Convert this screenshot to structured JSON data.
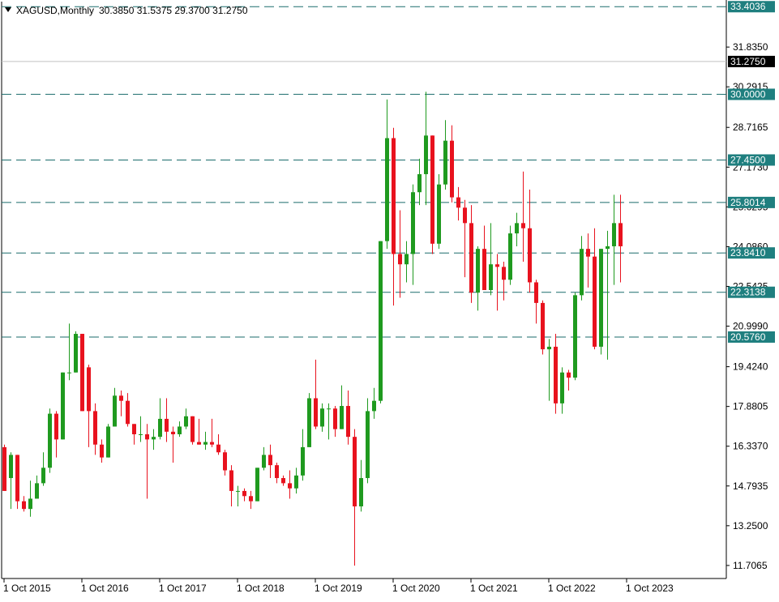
{
  "chart_data": {
    "type": "candlestick",
    "symbol": "XAGUSD",
    "timeframe": "Monthly",
    "header": {
      "symbol_timeframe": "XAGUSD,Monthly",
      "ohlc": "30.3850 31.5375 29.3700 31.2750"
    },
    "ylim": [
      11.2,
      33.6
    ],
    "y_ticks": [
      "31.8350",
      "30.2915",
      "28.7165",
      "27.1730",
      "25.6295",
      "24.0860",
      "22.5425",
      "20.9990",
      "19.4240",
      "17.8805",
      "16.3370",
      "14.7935",
      "13.2500",
      "11.7065"
    ],
    "y_tick_values": [
      31.835,
      30.2915,
      28.7165,
      27.173,
      25.6295,
      24.086,
      22.5425,
      20.999,
      19.424,
      17.8805,
      16.337,
      14.7935,
      13.25,
      11.7065
    ],
    "x_ticks": [
      {
        "label": "1 Oct 2015",
        "month_index": 0
      },
      {
        "label": "1 Oct 2016",
        "month_index": 12
      },
      {
        "label": "1 Oct 2017",
        "month_index": 24
      },
      {
        "label": "1 Oct 2018",
        "month_index": 36
      },
      {
        "label": "1 Oct 2019",
        "month_index": 48
      },
      {
        "label": "1 Oct 2020",
        "month_index": 60
      },
      {
        "label": "1 Oct 2021",
        "month_index": 72
      },
      {
        "label": "1 Oct 2022",
        "month_index": 84
      },
      {
        "label": "1 Oct 2023",
        "month_index": 96
      }
    ],
    "horizontal_levels": [
      {
        "value": 33.4036,
        "label": "33.4036",
        "style": "dashed",
        "color": "#1a6b6b"
      },
      {
        "value": 30.0,
        "label": "30.0000",
        "style": "dashed",
        "color": "#1a6b6b"
      },
      {
        "value": 27.45,
        "label": "27.4500",
        "style": "dashed",
        "color": "#1a6b6b"
      },
      {
        "value": 25.8014,
        "label": "25.8014",
        "style": "dashed",
        "color": "#1a6b6b"
      },
      {
        "value": 23.841,
        "label": "23.8410",
        "style": "dashed",
        "color": "#1a6b6b"
      },
      {
        "value": 22.3138,
        "label": "22.3138",
        "style": "dashed",
        "color": "#1a6b6b"
      },
      {
        "value": 20.576,
        "label": "20.5760",
        "style": "dashed",
        "color": "#1a6b6b"
      }
    ],
    "current_price": {
      "value": 31.275,
      "label": "31.2750"
    },
    "colors": {
      "up": "#1f9a1f",
      "down": "#e8121e",
      "level": "#1a6b6b",
      "level_label_bg": "#1f7f7f",
      "price_label_bg": "#000000",
      "price_line": "#c0c0c0"
    },
    "first_month": "2015-09",
    "candles": [
      {
        "o": 16.3,
        "h": 16.4,
        "l": 14.7,
        "c": 14.6
      },
      {
        "o": 15.1,
        "h": 16.1,
        "l": 13.9,
        "c": 16.0
      },
      {
        "o": 16.0,
        "h": 16.0,
        "l": 13.9,
        "c": 14.2
      },
      {
        "o": 14.2,
        "h": 14.4,
        "l": 13.8,
        "c": 13.9
      },
      {
        "o": 13.9,
        "h": 15.0,
        "l": 13.6,
        "c": 14.3
      },
      {
        "o": 14.3,
        "h": 15.2,
        "l": 14.3,
        "c": 14.9
      },
      {
        "o": 14.9,
        "h": 16.1,
        "l": 14.8,
        "c": 15.5
      },
      {
        "o": 15.5,
        "h": 17.8,
        "l": 15.3,
        "c": 17.6
      },
      {
        "o": 17.6,
        "h": 17.7,
        "l": 15.9,
        "c": 16.6
      },
      {
        "o": 16.6,
        "h": 18.9,
        "l": 16.6,
        "c": 19.2
      },
      {
        "o": 19.2,
        "h": 21.1,
        "l": 18.9,
        "c": 19.2
      },
      {
        "o": 19.2,
        "h": 20.8,
        "l": 19.2,
        "c": 20.7
      },
      {
        "o": 20.7,
        "h": 20.0,
        "l": 18.0,
        "c": 17.7
      },
      {
        "o": 19.4,
        "h": 19.5,
        "l": 16.3,
        "c": 17.7
      },
      {
        "o": 17.7,
        "h": 18.0,
        "l": 16.0,
        "c": 16.4
      },
      {
        "o": 16.4,
        "h": 16.6,
        "l": 15.7,
        "c": 15.9
      },
      {
        "o": 15.9,
        "h": 17.2,
        "l": 15.9,
        "c": 17.1
      },
      {
        "o": 17.1,
        "h": 18.6,
        "l": 17.1,
        "c": 18.3
      },
      {
        "o": 18.3,
        "h": 18.5,
        "l": 17.5,
        "c": 18.1
      },
      {
        "o": 18.1,
        "h": 18.4,
        "l": 17.1,
        "c": 17.2
      },
      {
        "o": 17.2,
        "h": 17.2,
        "l": 16.4,
        "c": 16.8
      },
      {
        "o": 16.8,
        "h": 17.5,
        "l": 16.5,
        "c": 16.8
      },
      {
        "o": 16.8,
        "h": 17.2,
        "l": 14.3,
        "c": 16.6
      },
      {
        "o": 16.6,
        "h": 17.0,
        "l": 16.2,
        "c": 16.7
      },
      {
        "o": 16.7,
        "h": 18.2,
        "l": 16.6,
        "c": 17.4
      },
      {
        "o": 17.4,
        "h": 18.2,
        "l": 16.5,
        "c": 16.9
      },
      {
        "o": 16.9,
        "h": 17.1,
        "l": 15.7,
        "c": 16.8
      },
      {
        "o": 16.8,
        "h": 17.3,
        "l": 16.7,
        "c": 17.1
      },
      {
        "o": 17.1,
        "h": 17.8,
        "l": 17.0,
        "c": 17.5
      },
      {
        "o": 17.5,
        "h": 17.5,
        "l": 16.4,
        "c": 16.5
      },
      {
        "o": 16.5,
        "h": 17.4,
        "l": 16.4,
        "c": 16.4
      },
      {
        "o": 16.4,
        "h": 16.9,
        "l": 16.2,
        "c": 16.5
      },
      {
        "o": 16.5,
        "h": 17.4,
        "l": 16.3,
        "c": 16.4
      },
      {
        "o": 16.4,
        "h": 16.8,
        "l": 16.0,
        "c": 16.1
      },
      {
        "o": 16.1,
        "h": 16.2,
        "l": 15.2,
        "c": 15.4
      },
      {
        "o": 15.4,
        "h": 15.6,
        "l": 14.0,
        "c": 14.6
      },
      {
        "o": 14.6,
        "h": 14.8,
        "l": 14.0,
        "c": 14.6
      },
      {
        "o": 14.6,
        "h": 14.7,
        "l": 14.2,
        "c": 14.4
      },
      {
        "o": 14.4,
        "h": 14.6,
        "l": 13.9,
        "c": 14.2
      },
      {
        "o": 14.2,
        "h": 15.5,
        "l": 14.2,
        "c": 15.5
      },
      {
        "o": 15.5,
        "h": 16.3,
        "l": 15.4,
        "c": 16.0
      },
      {
        "o": 16.0,
        "h": 16.4,
        "l": 15.1,
        "c": 15.6
      },
      {
        "o": 15.6,
        "h": 15.7,
        "l": 14.9,
        "c": 15.1
      },
      {
        "o": 15.1,
        "h": 15.2,
        "l": 14.8,
        "c": 14.9
      },
      {
        "o": 14.9,
        "h": 15.4,
        "l": 14.3,
        "c": 14.7
      },
      {
        "o": 14.7,
        "h": 15.5,
        "l": 14.5,
        "c": 15.2
      },
      {
        "o": 15.2,
        "h": 17.0,
        "l": 15.0,
        "c": 16.3
      },
      {
        "o": 16.3,
        "h": 18.4,
        "l": 16.3,
        "c": 18.2
      },
      {
        "o": 18.2,
        "h": 19.7,
        "l": 17.0,
        "c": 17.1
      },
      {
        "o": 17.1,
        "h": 18.0,
        "l": 16.9,
        "c": 17.8
      },
      {
        "o": 17.8,
        "h": 18.0,
        "l": 16.6,
        "c": 17.8
      },
      {
        "o": 17.8,
        "h": 17.9,
        "l": 16.7,
        "c": 17.0
      },
      {
        "o": 17.0,
        "h": 18.7,
        "l": 17.0,
        "c": 17.9
      },
      {
        "o": 17.9,
        "h": 18.5,
        "l": 16.4,
        "c": 16.7
      },
      {
        "o": 16.7,
        "h": 17.0,
        "l": 11.7,
        "c": 14.0
      },
      {
        "o": 14.0,
        "h": 15.8,
        "l": 13.8,
        "c": 15.1
      },
      {
        "o": 15.1,
        "h": 18.2,
        "l": 14.9,
        "c": 17.7
      },
      {
        "o": 17.7,
        "h": 18.6,
        "l": 17.4,
        "c": 18.1
      },
      {
        "o": 18.1,
        "h": 24.3,
        "l": 18.0,
        "c": 24.3
      },
      {
        "o": 24.3,
        "h": 29.8,
        "l": 24.0,
        "c": 28.3
      },
      {
        "o": 28.3,
        "h": 28.7,
        "l": 21.8,
        "c": 23.8
      },
      {
        "o": 23.8,
        "h": 25.5,
        "l": 22.1,
        "c": 23.4
      },
      {
        "o": 23.4,
        "h": 24.3,
        "l": 22.7,
        "c": 23.8
      },
      {
        "o": 23.8,
        "h": 26.5,
        "l": 22.6,
        "c": 26.2
      },
      {
        "o": 26.2,
        "h": 27.5,
        "l": 25.7,
        "c": 26.9
      },
      {
        "o": 26.9,
        "h": 30.1,
        "l": 25.7,
        "c": 28.4
      },
      {
        "o": 28.4,
        "h": 26.6,
        "l": 23.8,
        "c": 24.2
      },
      {
        "o": 24.2,
        "h": 26.9,
        "l": 24.0,
        "c": 26.5
      },
      {
        "o": 26.5,
        "h": 29.0,
        "l": 26.3,
        "c": 28.2
      },
      {
        "o": 28.2,
        "h": 28.8,
        "l": 25.8,
        "c": 26.0
      },
      {
        "o": 26.0,
        "h": 26.4,
        "l": 25.1,
        "c": 25.6
      },
      {
        "o": 25.6,
        "h": 25.9,
        "l": 22.9,
        "c": 25.0
      },
      {
        "o": 25.0,
        "h": 25.7,
        "l": 21.9,
        "c": 22.3
      },
      {
        "o": 22.3,
        "h": 24.1,
        "l": 21.6,
        "c": 24.0
      },
      {
        "o": 24.0,
        "h": 24.9,
        "l": 22.4,
        "c": 22.4
      },
      {
        "o": 22.4,
        "h": 25.0,
        "l": 22.2,
        "c": 23.4
      },
      {
        "o": 23.4,
        "h": 23.8,
        "l": 21.6,
        "c": 23.3
      },
      {
        "o": 23.3,
        "h": 23.5,
        "l": 22.0,
        "c": 22.8
      },
      {
        "o": 22.8,
        "h": 24.9,
        "l": 22.6,
        "c": 24.6
      },
      {
        "o": 24.6,
        "h": 25.4,
        "l": 24.1,
        "c": 25.0
      },
      {
        "o": 25.0,
        "h": 27.0,
        "l": 23.5,
        "c": 24.8
      },
      {
        "o": 24.8,
        "h": 26.3,
        "l": 22.3,
        "c": 22.7
      },
      {
        "o": 22.7,
        "h": 22.8,
        "l": 21.1,
        "c": 21.9
      },
      {
        "o": 21.9,
        "h": 22.0,
        "l": 19.9,
        "c": 20.1
      },
      {
        "o": 20.1,
        "h": 20.5,
        "l": 18.1,
        "c": 20.2
      },
      {
        "o": 20.2,
        "h": 20.7,
        "l": 17.6,
        "c": 18.0
      },
      {
        "o": 18.0,
        "h": 19.4,
        "l": 17.6,
        "c": 19.2
      },
      {
        "o": 19.2,
        "h": 19.3,
        "l": 18.5,
        "c": 19.0
      },
      {
        "o": 19.0,
        "h": 22.3,
        "l": 18.9,
        "c": 22.2
      },
      {
        "o": 22.2,
        "h": 24.5,
        "l": 22.0,
        "c": 24.0
      },
      {
        "o": 24.0,
        "h": 24.6,
        "l": 22.5,
        "c": 23.7
      },
      {
        "o": 23.7,
        "h": 24.8,
        "l": 20.1,
        "c": 20.2
      },
      {
        "o": 20.2,
        "h": 21.4,
        "l": 19.9,
        "c": 24.0
      },
      {
        "o": 24.0,
        "h": 24.7,
        "l": 19.7,
        "c": 24.1
      },
      {
        "o": 24.1,
        "h": 26.1,
        "l": 22.6,
        "c": 25.0
      },
      {
        "o": 25.0,
        "h": 26.1,
        "l": 22.7,
        "c": 24.1
      }
    ]
  }
}
